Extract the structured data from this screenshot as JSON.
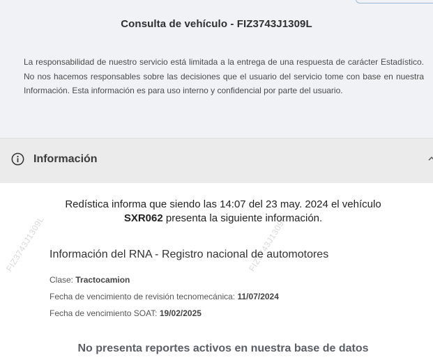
{
  "page": {
    "title": "Consulta de vehículo - FIZ3743J1309L",
    "disclaimer": "La responsabilidad de nuestro servicio está limitada a la entrega de una respuesta de carácter Estadístico. No nos hacemos responsables sobre las decisiones que el usuario del servicio tome con base en nuestra Información. Esta información es para uso interno y confidencial por parte del usuario."
  },
  "section": {
    "title": "Información",
    "icon": "info-icon",
    "toggle_icon": "chevron-up-icon"
  },
  "report": {
    "intro_before": "Redística informa que siendo las 14:07 del 23 may. 2024 el vehículo",
    "plate": "SXR062",
    "intro_after": "presenta la siguiente información.",
    "watermark": "FIZ3743J1309L",
    "rna_title": "Información del RNA - Registro nacional de automotores",
    "fields": [
      {
        "label": "Clase:",
        "value": "Tractocamion"
      },
      {
        "label": "Fecha de vencimiento de revisión tecnomecánica:",
        "value": "11/07/2024"
      },
      {
        "label": "Fecha de vencimiento SOAT:",
        "value": "19/02/2025"
      }
    ],
    "no_reports": "No presenta reportes activos en nuestra base de datos"
  },
  "colors": {
    "top_background": "#f0f2f5",
    "header_background": "#ebebeb",
    "text_dark": "#333333"
  }
}
